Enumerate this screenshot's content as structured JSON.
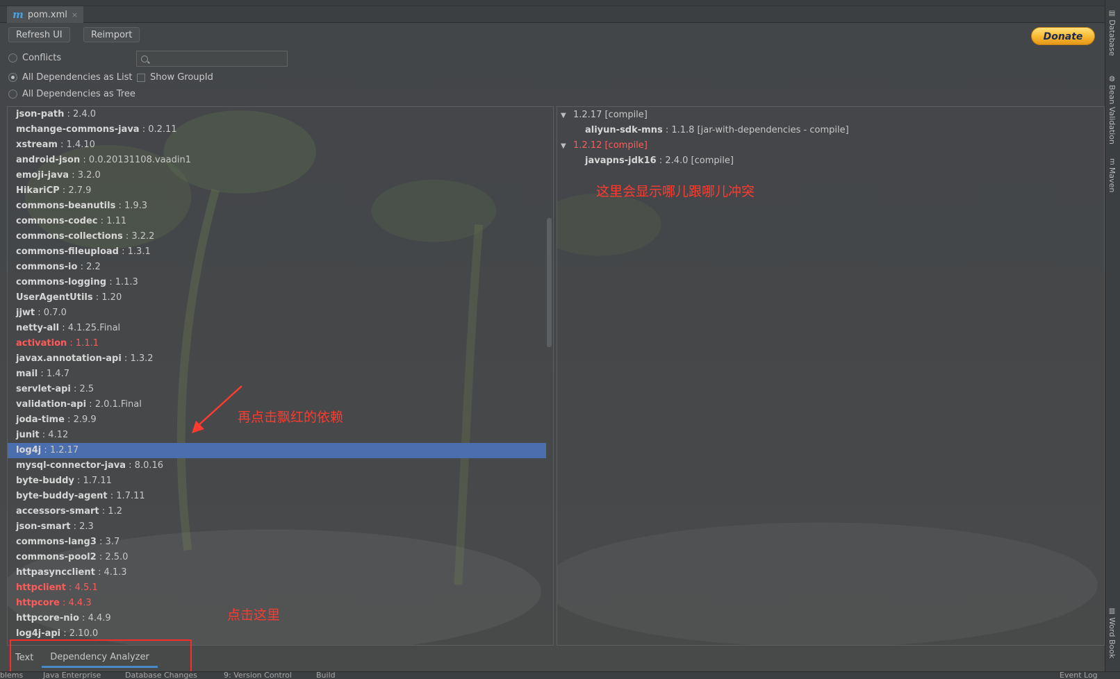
{
  "editor_tab": {
    "icon": "maven-icon",
    "label": "pom.xml",
    "close": "×"
  },
  "toolbar": {
    "refresh": "Refresh UI",
    "reimport": "Reimport",
    "donate": "Donate"
  },
  "options": {
    "conflicts": "Conflicts",
    "list": "All Dependencies as List",
    "tree": "All Dependencies as Tree",
    "show_group_id": "Show GroupId",
    "selected": "list"
  },
  "search": {
    "value": "",
    "placeholder": ""
  },
  "dependencies": [
    {
      "name": "json-path",
      "version": "2.4.0"
    },
    {
      "name": "mchange-commons-java",
      "version": "0.2.11"
    },
    {
      "name": "xstream",
      "version": "1.4.10"
    },
    {
      "name": "android-json",
      "version": "0.0.20131108.vaadin1"
    },
    {
      "name": "emoji-java",
      "version": "3.2.0"
    },
    {
      "name": "HikariCP",
      "version": "2.7.9"
    },
    {
      "name": "commons-beanutils",
      "version": "1.9.3"
    },
    {
      "name": "commons-codec",
      "version": "1.11"
    },
    {
      "name": "commons-collections",
      "version": "3.2.2"
    },
    {
      "name": "commons-fileupload",
      "version": "1.3.1"
    },
    {
      "name": "commons-io",
      "version": "2.2"
    },
    {
      "name": "commons-logging",
      "version": "1.1.3"
    },
    {
      "name": "UserAgentUtils",
      "version": "1.20"
    },
    {
      "name": "jjwt",
      "version": "0.7.0"
    },
    {
      "name": "netty-all",
      "version": "4.1.25.Final"
    },
    {
      "name": "activation",
      "version": "1.1.1",
      "conflict": true
    },
    {
      "name": "javax.annotation-api",
      "version": "1.3.2"
    },
    {
      "name": "mail",
      "version": "1.4.7"
    },
    {
      "name": "servlet-api",
      "version": "2.5"
    },
    {
      "name": "validation-api",
      "version": "2.0.1.Final"
    },
    {
      "name": "joda-time",
      "version": "2.9.9"
    },
    {
      "name": "junit",
      "version": "4.12"
    },
    {
      "name": "log4j",
      "version": "1.2.17",
      "selected": true
    },
    {
      "name": "mysql-connector-java",
      "version": "8.0.16"
    },
    {
      "name": "byte-buddy",
      "version": "1.7.11"
    },
    {
      "name": "byte-buddy-agent",
      "version": "1.7.11"
    },
    {
      "name": "accessors-smart",
      "version": "1.2"
    },
    {
      "name": "json-smart",
      "version": "2.3"
    },
    {
      "name": "commons-lang3",
      "version": "3.7"
    },
    {
      "name": "commons-pool2",
      "version": "2.5.0"
    },
    {
      "name": "httpasyncclient",
      "version": "4.1.3"
    },
    {
      "name": "httpclient",
      "version": "4.5.1",
      "conflict": true
    },
    {
      "name": "httpcore",
      "version": "4.4.3",
      "conflict": true
    },
    {
      "name": "httpcore-nio",
      "version": "4.4.9"
    },
    {
      "name": "log4j-api",
      "version": "2.10.0"
    }
  ],
  "detail_tree": [
    {
      "level": 0,
      "text": "1.2.17 [compile]",
      "conflict": false
    },
    {
      "level": 1,
      "name": "aliyun-sdk-mns",
      "rest": " : 1.1.8 [jar-with-dependencies - compile]"
    },
    {
      "level": 0,
      "text": "1.2.12 [compile]",
      "conflict": true
    },
    {
      "level": 1,
      "name": "javapns-jdk16",
      "rest": " : 2.4.0 [compile]"
    }
  ],
  "annotations": {
    "right": "这里会显示哪儿跟哪儿冲突",
    "left": "再点击飘红的依赖",
    "bottom": "点击这里"
  },
  "bottom_tabs": [
    "Text",
    "Dependency Analyzer"
  ],
  "active_bottom_tab": "Dependency Analyzer",
  "status_bar": [
    "blems",
    "Java Enterprise",
    "Database Changes",
    "9: Version Control",
    "Build",
    "Event Log"
  ],
  "right_tool_windows": [
    "Database",
    "Bean Validation",
    "Maven",
    "Word Book"
  ],
  "colors": {
    "conflict": "#ff5b5b",
    "selection": "#4b6eaf",
    "annotation": "#ff3b30",
    "accent": "#4a88c7"
  }
}
